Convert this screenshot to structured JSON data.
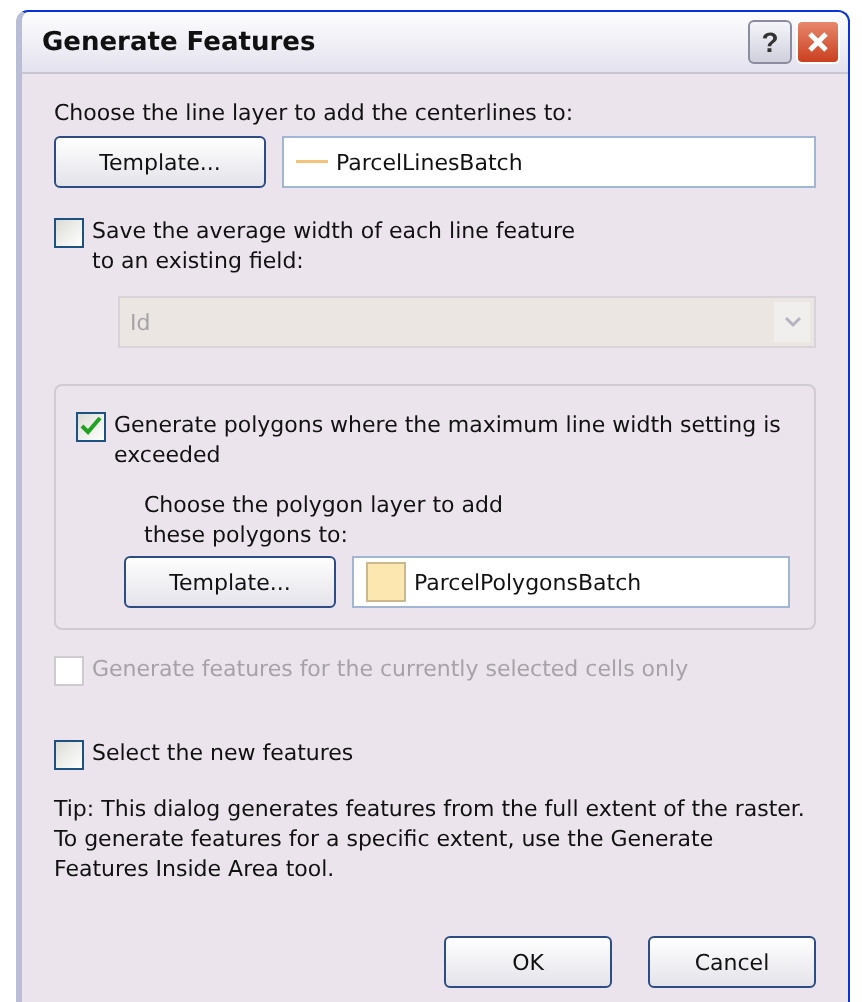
{
  "window": {
    "title": "Generate Features",
    "help_button": "?"
  },
  "line_layer": {
    "label": "Choose the line layer to add the centerlines to:",
    "button": "Template...",
    "value": "ParcelLinesBatch",
    "kind": "line"
  },
  "save_width": {
    "label_lines": [
      "Save the average width of each line feature",
      "to an existing field:"
    ],
    "checked": false,
    "disabled": false
  },
  "field_dropdown": {
    "value": "Id",
    "disabled": true
  },
  "polygons": {
    "label_lines": [
      "Generate polygons where the maximum line width setting is",
      "exceeded"
    ],
    "checked": true,
    "disabled": false,
    "layer_label_lines": [
      "Choose the polygon layer to add",
      "these polygons to:"
    ],
    "button": "Template...",
    "value": "ParcelPolygonsBatch",
    "kind": "fill"
  },
  "selected_cells": {
    "label_lines": [
      "Generate features for the currently selected cells only"
    ],
    "checked": false,
    "disabled": true
  },
  "select_new": {
    "label_lines": [
      "Select the new features"
    ],
    "checked": false,
    "disabled": false
  },
  "tip_lines": [
    "Tip:  This dialog generates features from the full extent of the raster.",
    "To generate features for a specific extent, use the Generate",
    "Features Inside Area tool."
  ],
  "buttons": [
    "OK",
    "Cancel"
  ]
}
